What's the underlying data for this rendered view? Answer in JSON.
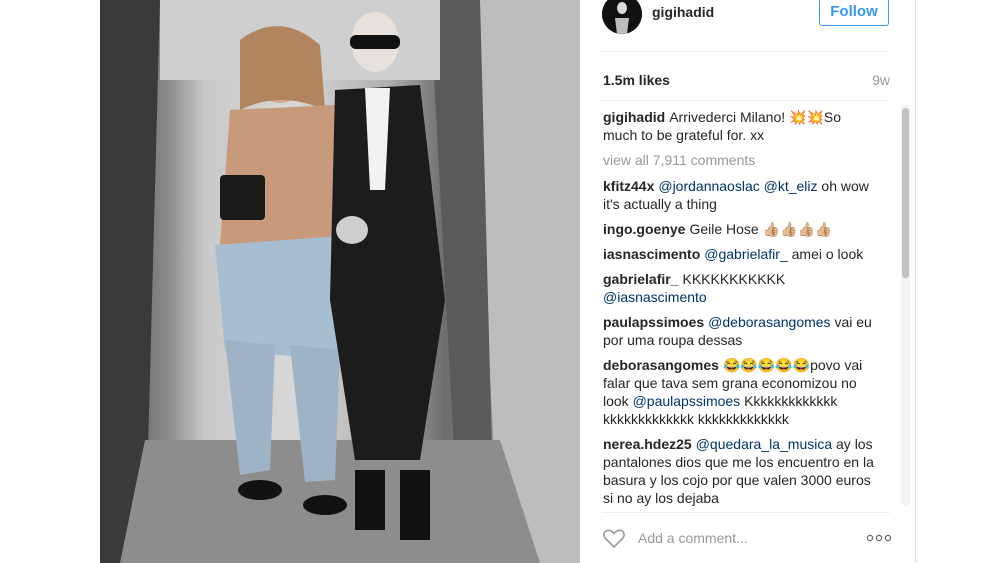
{
  "post": {
    "username": "gigihadid",
    "follow_label": "Follow",
    "likes": "1.5m likes",
    "age": "9w",
    "caption": {
      "user": "gigihadid",
      "text": "Arrivederci Milano! 💥💥So much to be grateful for. xx"
    },
    "view_all": "view all 7,911 comments",
    "comments": [
      {
        "user": "kfitz44x",
        "mention": "@jordannaoslac @kt_eliz",
        "text": " oh wow it's actually a thing"
      },
      {
        "user": "ingo.goenye",
        "mention": "",
        "text": "Geile Hose 👍🏼👍🏼👍🏼👍🏼"
      },
      {
        "user": "iasnascimento",
        "mention": "@gabrielafir_",
        "text": " amei o look"
      },
      {
        "user": "gabrielafir_",
        "mention": "",
        "text": "KKKKKKKKKKK ",
        "mention2": "@iasnascimento"
      },
      {
        "user": "paulapssimoes",
        "mention": "@deborasangomes",
        "text": " vai eu por uma roupa dessas"
      },
      {
        "user": "deborasangomes",
        "mention": "",
        "text": "😂😂😂😂😂povo vai falar que tava sem grana economizou no look ",
        "mention2": "@paulapssimoes",
        "text2": " Kkkkkkkkkkkkk kkkkkkkkkkkkk kkkkkkkkkkkkk"
      },
      {
        "user": "nerea.hdez25",
        "mention": "@quedara_la_musica",
        "text": " ay los pantalones dios que me los encuentro en la basura y los cojo por que valen 3000 euros si no ay los dejaba"
      }
    ],
    "add_comment_placeholder": "Add a comment...",
    "colors": {
      "link": "#3897f0",
      "mention": "#003569",
      "muted": "#999999"
    }
  }
}
